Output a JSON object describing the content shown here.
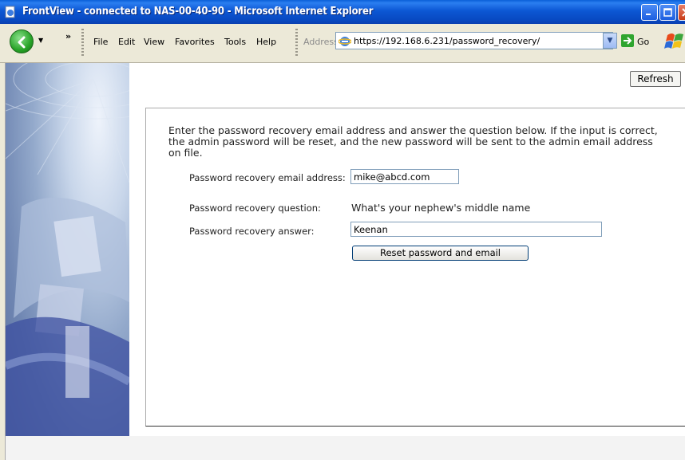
{
  "window": {
    "title": "FrontView - connected to NAS-00-40-90 - Microsoft Internet Explorer"
  },
  "toolbar": {
    "chevron": "»",
    "menu": [
      {
        "label": "File"
      },
      {
        "label": "Edit"
      },
      {
        "label": "View"
      },
      {
        "label": "Favorites"
      },
      {
        "label": "Tools"
      },
      {
        "label": "Help"
      }
    ],
    "address_label": "Address",
    "url": "https://192.168.6.231/password_recovery/",
    "go_label": "Go"
  },
  "page": {
    "refresh_label": "Refresh",
    "intro": "Enter the password recovery email address and answer the question below. If the input is correct, the admin password will be reset, and the new password will be sent to the admin email address on file.",
    "email_label": "Password recovery email address:",
    "email_value": "mike@abcd.com",
    "question_label": "Password recovery question:",
    "question_value": "What's your nephew's middle name",
    "answer_label": "Password recovery answer:",
    "answer_value": "Keenan",
    "reset_button": "Reset password and email"
  },
  "colors": {
    "titlebar": "#0c57d4",
    "chrome": "#ece9d8",
    "button_border": "#003c74"
  }
}
